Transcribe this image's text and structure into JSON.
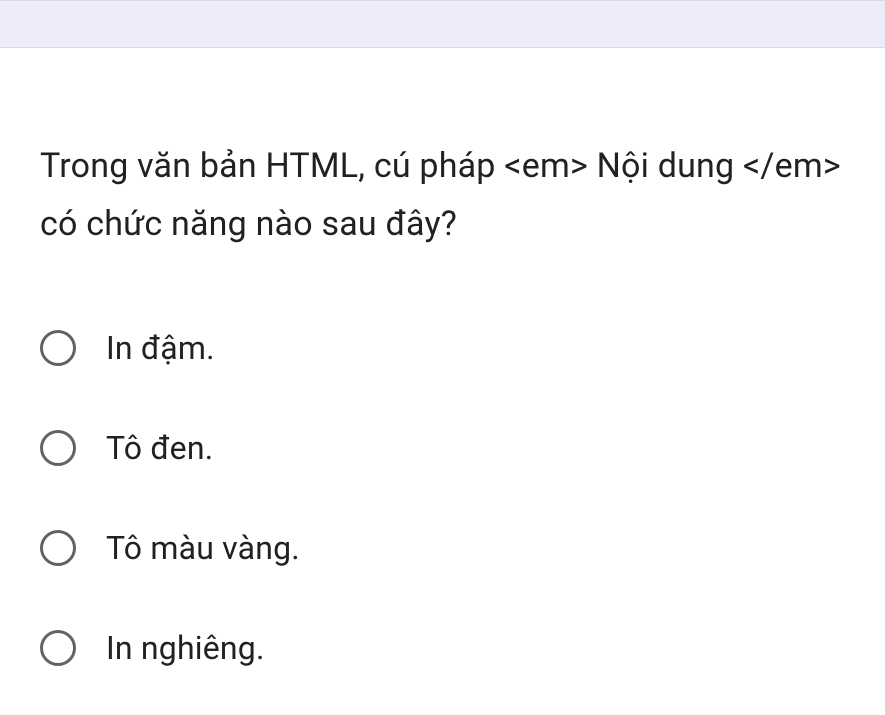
{
  "question": {
    "text": "Trong văn bản HTML, cú pháp <em> Nội dung </em> có chức năng nào sau đây?"
  },
  "options": [
    {
      "label": "In đậm."
    },
    {
      "label": "Tô đen."
    },
    {
      "label": "Tô màu vàng."
    },
    {
      "label": "In nghiêng."
    }
  ]
}
